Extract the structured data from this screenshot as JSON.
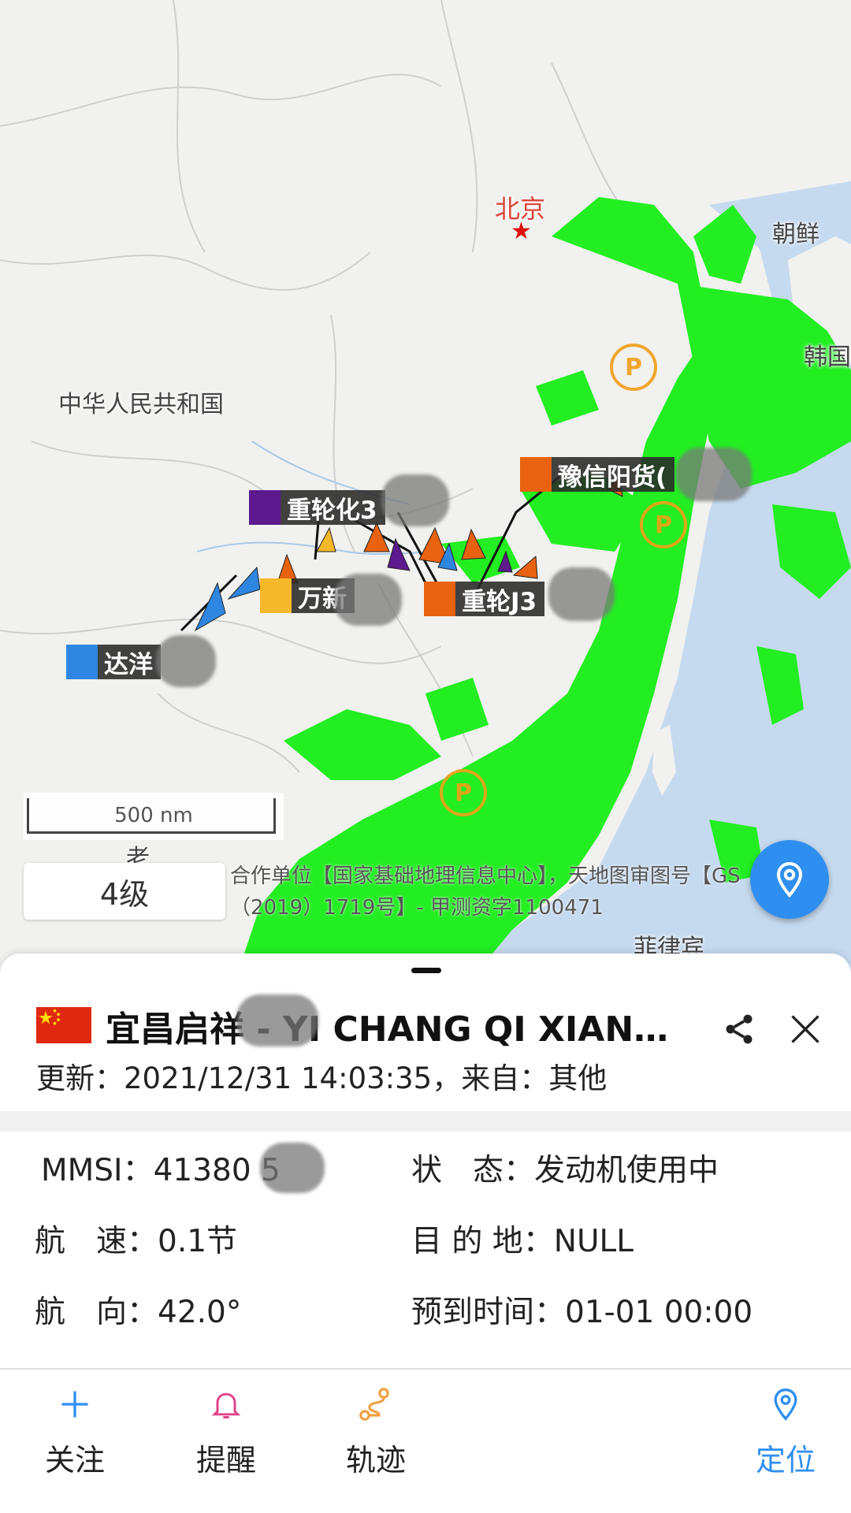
{
  "map": {
    "places": {
      "beijing": "北京",
      "north_korea": "朝鲜",
      "korea": "韩国",
      "china": "中华人民共和国",
      "philippines": "菲律宾",
      "laos": "老"
    },
    "ships": [
      {
        "label": "重轮化3",
        "color": "#5c1a8e"
      },
      {
        "label": "豫信阳货(",
        "color": "#e8620f"
      },
      {
        "label": "万新",
        "color": "#f5b82a"
      },
      {
        "label": "重轮J3",
        "color": "#e8620f"
      },
      {
        "label": "达洋",
        "color": "#2f86e0"
      }
    ],
    "port_symbol": "P",
    "scale_text": "500 nm",
    "zoom_level": "4级",
    "copyright": "合作单位【国家基础地理信息中心】，天地图审图号【GS（2019）1719号】- 甲测资字1100471",
    "colors": {
      "traffic": "#22ee22",
      "sea": "#c6daef",
      "land": "#f1f1ef",
      "accent": "#2f8ff0"
    }
  },
  "sheet": {
    "title": "宜昌启祥 - YI CHANG QI XIAN...",
    "update_line": "更新：2021/12/31 14:03:35，来自：其他",
    "info": {
      "mmsi_key": "MMSI：",
      "mmsi_value": "41380  5",
      "status_key": "状　态：",
      "status_value": "发动机使用中",
      "speed_key": "航　速：",
      "speed_value": "0.1节",
      "destination_key": "目 的 地：",
      "destination_value": "NULL",
      "course_key": "航　向：",
      "course_value": "42.0°",
      "eta_key": "预到时间：",
      "eta_value": "01-01 00:00"
    }
  },
  "nav": {
    "follow": "关注",
    "remind": "提醒",
    "track": "轨迹",
    "locate": "定位"
  },
  "icons": [
    "locate-pin-icon",
    "share-icon",
    "close-icon",
    "plus-icon",
    "bell-icon",
    "route-icon",
    "pin-icon",
    "china-flag-icon"
  ]
}
